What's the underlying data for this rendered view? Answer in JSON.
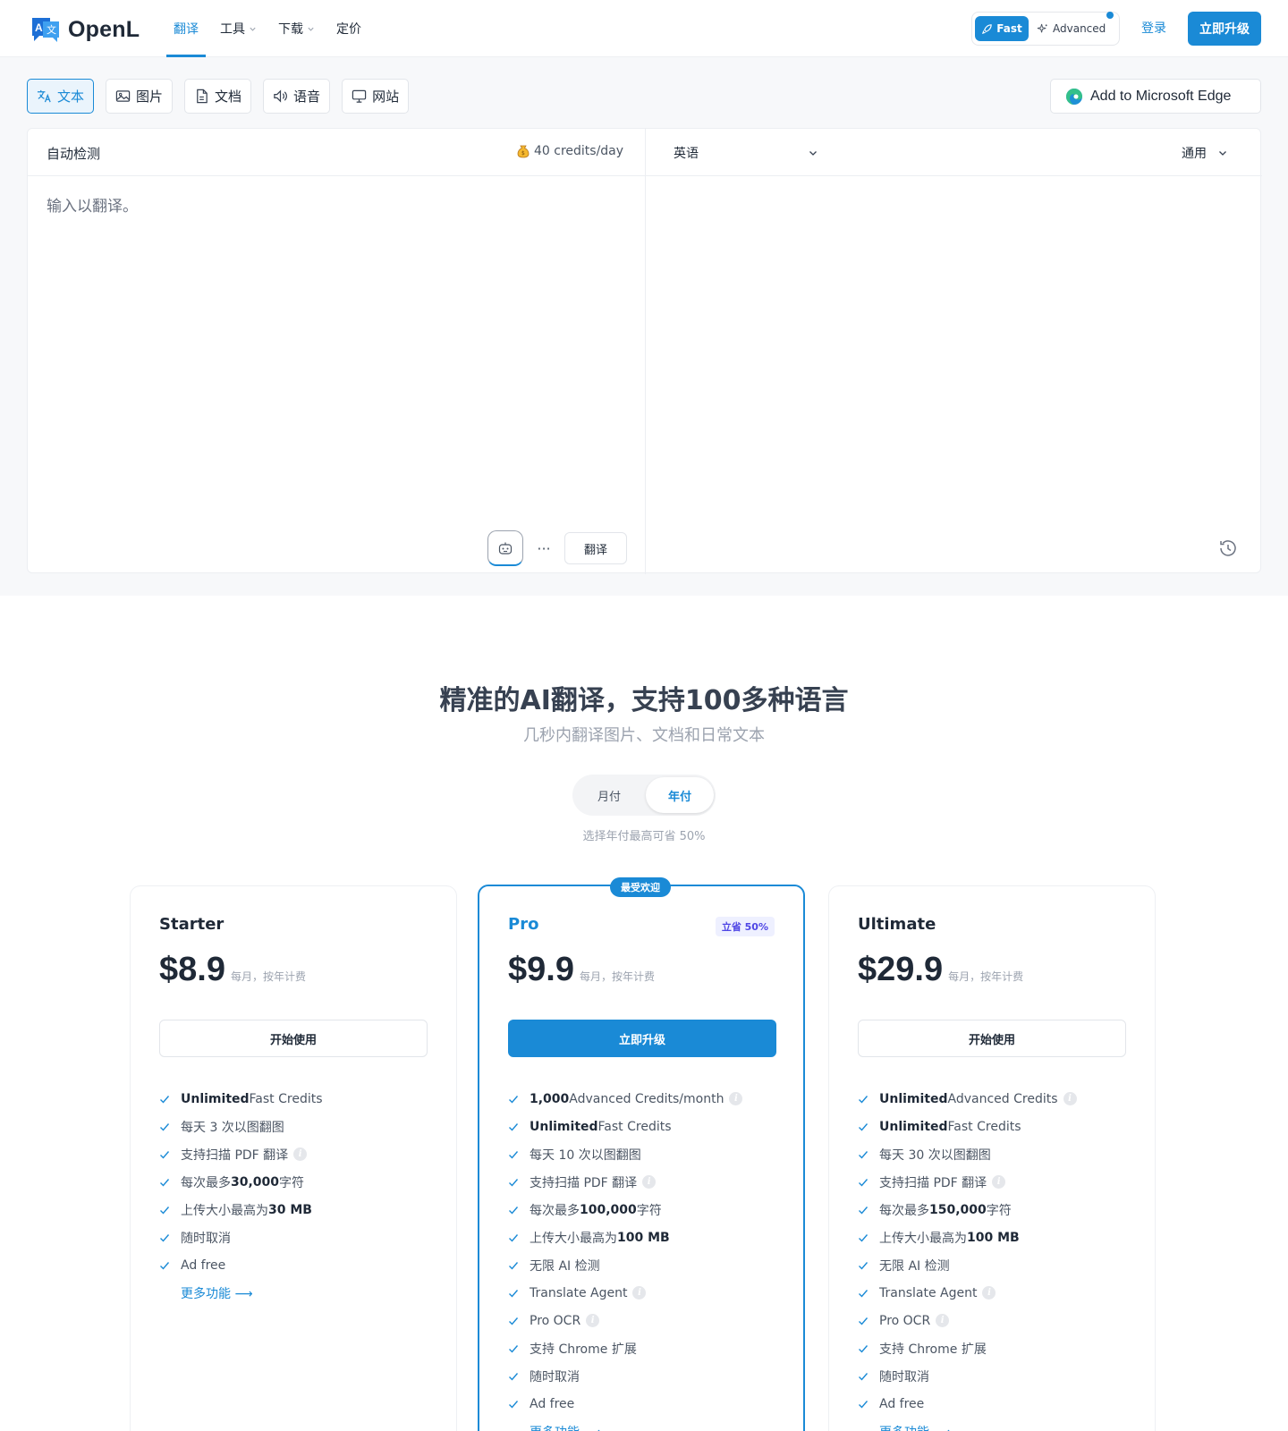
{
  "header": {
    "brand": "OpenL",
    "nav": [
      {
        "label": "翻译",
        "active": true,
        "caret": false
      },
      {
        "label": "工具",
        "active": false,
        "caret": true
      },
      {
        "label": "下载",
        "active": false,
        "caret": true
      },
      {
        "label": "定价",
        "active": false,
        "caret": false
      }
    ],
    "mode_fast": "Fast",
    "mode_advanced": "Advanced",
    "login": "登录",
    "upgrade": "立即升级"
  },
  "tools": {
    "tabs": [
      {
        "label": "文本",
        "icon": "translate-icon",
        "active": true
      },
      {
        "label": "图片",
        "icon": "image-icon",
        "active": false
      },
      {
        "label": "文档",
        "icon": "document-icon",
        "active": false
      },
      {
        "label": "语音",
        "icon": "speaker-icon",
        "active": false
      },
      {
        "label": "网站",
        "icon": "monitor-icon",
        "active": false
      }
    ],
    "edge_button": "Add to Microsoft Edge"
  },
  "translator": {
    "source_lang": "自动检测",
    "credits": "40 credits/day",
    "target_lang": "英语",
    "tone": "通用",
    "placeholder": "输入以翻译。",
    "more_label": "···",
    "translate_button": "翻译"
  },
  "pricing": {
    "title": "精准的AI翻译，支持100多种语言",
    "subtitle": "几秒内翻译图片、文档和日常文本",
    "billing_monthly": "月付",
    "billing_yearly": "年付",
    "billing_note": "选择年付最高可省 50%",
    "plans": [
      {
        "name": "Starter",
        "price": "$8.9",
        "price_note": "每月，按年计费",
        "button": "开始使用",
        "features": [
          {
            "strong": "Unlimited",
            "text": " Fast Credits",
            "info": false
          },
          {
            "strong": "",
            "text": "每天 3 次以图翻图",
            "info": false
          },
          {
            "strong": "",
            "text": "支持扫描 PDF 翻译",
            "info": true
          },
          {
            "pre": "每次最多 ",
            "strong": "30,000",
            "text": " 字符",
            "info": false
          },
          {
            "pre": "上传大小最高为 ",
            "strong": "30 MB",
            "text": "",
            "info": false
          },
          {
            "strong": "",
            "text": "随时取消",
            "info": false
          },
          {
            "strong": "",
            "text": "Ad free",
            "info": false
          }
        ],
        "more": "更多功能 ⟶"
      },
      {
        "name": "Pro",
        "badge": "立省 50%",
        "popular": "最受欢迎",
        "price": "$9.9",
        "price_note": "每月，按年计费",
        "button": "立即升级",
        "features": [
          {
            "strong": "1,000",
            "text": " Advanced Credits/month",
            "info": true
          },
          {
            "strong": "Unlimited",
            "text": " Fast Credits",
            "info": false
          },
          {
            "strong": "",
            "text": "每天 10 次以图翻图",
            "info": false
          },
          {
            "strong": "",
            "text": "支持扫描 PDF 翻译",
            "info": true
          },
          {
            "pre": "每次最多 ",
            "strong": "100,000",
            "text": " 字符",
            "info": false
          },
          {
            "pre": "上传大小最高为 ",
            "strong": "100 MB",
            "text": "",
            "info": false
          },
          {
            "strong": "",
            "text": "无限 AI 检测",
            "info": false
          },
          {
            "strong": "",
            "text": "Translate Agent",
            "info": true
          },
          {
            "strong": "",
            "text": "Pro OCR",
            "info": true
          },
          {
            "strong": "",
            "text": "支持 Chrome 扩展",
            "info": false
          },
          {
            "strong": "",
            "text": "随时取消",
            "info": false
          },
          {
            "strong": "",
            "text": "Ad free",
            "info": false
          }
        ],
        "more": "更多功能 ⟶"
      },
      {
        "name": "Ultimate",
        "price": "$29.9",
        "price_note": "每月，按年计费",
        "button": "开始使用",
        "features": [
          {
            "strong": "Unlimited",
            "text": " Advanced Credits",
            "info": true
          },
          {
            "strong": "Unlimited",
            "text": " Fast Credits",
            "info": false
          },
          {
            "strong": "",
            "text": "每天 30 次以图翻图",
            "info": false
          },
          {
            "strong": "",
            "text": "支持扫描 PDF 翻译",
            "info": true
          },
          {
            "pre": "每次最多 ",
            "strong": "150,000",
            "text": " 字符",
            "info": false
          },
          {
            "pre": "上传大小最高为 ",
            "strong": "100 MB",
            "text": "",
            "info": false
          },
          {
            "strong": "",
            "text": "无限 AI 检测",
            "info": false
          },
          {
            "strong": "",
            "text": "Translate Agent",
            "info": true
          },
          {
            "strong": "",
            "text": "Pro OCR",
            "info": true
          },
          {
            "strong": "",
            "text": "支持 Chrome 扩展",
            "info": false
          },
          {
            "strong": "",
            "text": "随时取消",
            "info": false
          },
          {
            "strong": "",
            "text": "Ad free",
            "info": false
          }
        ],
        "more": "更多功能 ⟶"
      }
    ]
  },
  "colors": {
    "accent": "#1a8ad6",
    "badge_text": "#4f46e5",
    "page_bg": "#f7f8fa"
  }
}
